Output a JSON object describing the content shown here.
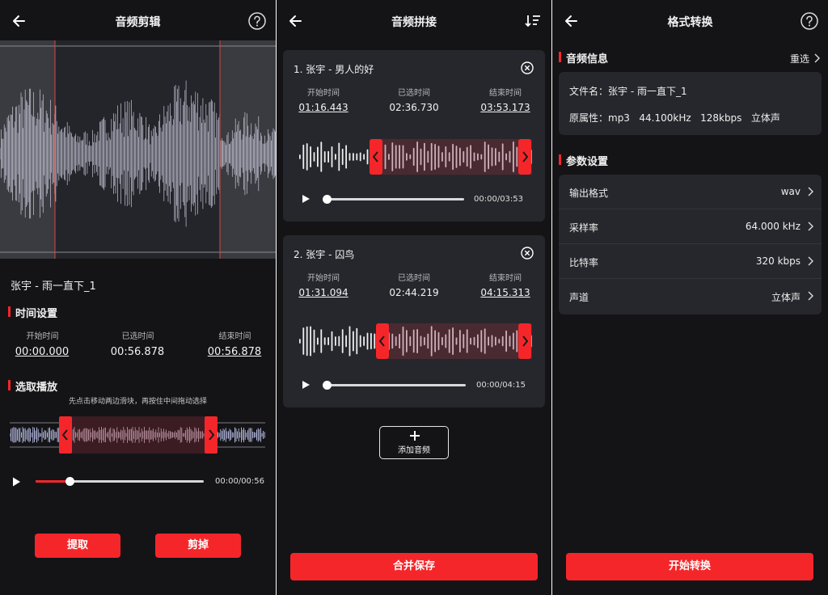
{
  "panel1": {
    "title": "音频剪辑",
    "track_name": "张宇 - 雨一直下_1",
    "time_section": "时间设置",
    "start_label": "开始时间",
    "selected_label": "已选时间",
    "end_label": "结束时间",
    "start_value": "00:00.000",
    "selected_value": "00:56.878",
    "end_value": "00:56.878",
    "play_section": "选取播放",
    "hint": "先点击移动两边滑块，再按住中间拖动选择",
    "play_time": "00:00/00:56",
    "progress_fraction": 0.2,
    "extract_label": "提取",
    "cut_label": "剪掉"
  },
  "panel2": {
    "title": "音频拼接",
    "tracks": [
      {
        "name": "1. 张宇 - 男人的好",
        "start_label": "开始时间",
        "selected_label": "已选时间",
        "end_label": "结束时间",
        "start_value": "01:16.443",
        "selected_value": "02:36.730",
        "end_value": "03:53.173",
        "play_time": "00:00/03:53"
      },
      {
        "name": "2. 张宇 - 囚鸟",
        "start_label": "开始时间",
        "selected_label": "已选时间",
        "end_label": "结束时间",
        "start_value": "01:31.094",
        "selected_value": "02:44.219",
        "end_value": "04:15.313",
        "play_time": "00:00/04:15"
      }
    ],
    "add_label": "添加音频",
    "save_label": "合并保存"
  },
  "panel3": {
    "title": "格式转换",
    "info_section": "音频信息",
    "reselect_label": "重选",
    "filename_label": "文件名：张宇 - 雨一直下_1",
    "props_label": "原属性：mp3   44.100kHz   128kbps   立体声",
    "param_section": "参数设置",
    "rows": [
      {
        "key": "输出格式",
        "value": "wav"
      },
      {
        "key": "采样率",
        "value": "64.000 kHz"
      },
      {
        "key": "比特率",
        "value": "320 kbps"
      },
      {
        "key": "声道",
        "value": "立体声"
      }
    ],
    "convert_label": "开始转换"
  },
  "colors": {
    "accent": "#f5262a",
    "background": "#141417",
    "card": "#26272c",
    "waveform": "#d8d6f0"
  },
  "icons": [
    "back-arrow-icon",
    "help-icon",
    "sort-icon",
    "close-circle-icon",
    "play-icon",
    "plus-icon",
    "chevron-right-icon"
  ]
}
